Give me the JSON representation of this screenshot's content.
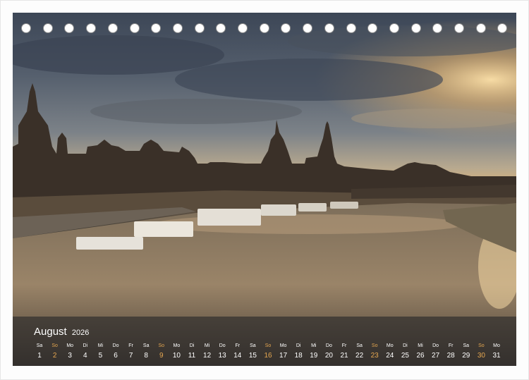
{
  "calendar": {
    "month": "August",
    "year": "2026",
    "days": [
      {
        "wd": "Sa",
        "n": "1",
        "sunday": false
      },
      {
        "wd": "So",
        "n": "2",
        "sunday": true
      },
      {
        "wd": "Mo",
        "n": "3",
        "sunday": false
      },
      {
        "wd": "Di",
        "n": "4",
        "sunday": false
      },
      {
        "wd": "Mi",
        "n": "5",
        "sunday": false
      },
      {
        "wd": "Do",
        "n": "6",
        "sunday": false
      },
      {
        "wd": "Fr",
        "n": "7",
        "sunday": false
      },
      {
        "wd": "Sa",
        "n": "8",
        "sunday": false
      },
      {
        "wd": "So",
        "n": "9",
        "sunday": true
      },
      {
        "wd": "Mo",
        "n": "10",
        "sunday": false
      },
      {
        "wd": "Di",
        "n": "11",
        "sunday": false
      },
      {
        "wd": "Mi",
        "n": "12",
        "sunday": false
      },
      {
        "wd": "Do",
        "n": "13",
        "sunday": false
      },
      {
        "wd": "Fr",
        "n": "14",
        "sunday": false
      },
      {
        "wd": "Sa",
        "n": "15",
        "sunday": false
      },
      {
        "wd": "So",
        "n": "16",
        "sunday": true
      },
      {
        "wd": "Mo",
        "n": "17",
        "sunday": false
      },
      {
        "wd": "Di",
        "n": "18",
        "sunday": false
      },
      {
        "wd": "Mi",
        "n": "19",
        "sunday": false
      },
      {
        "wd": "Do",
        "n": "20",
        "sunday": false
      },
      {
        "wd": "Fr",
        "n": "21",
        "sunday": false
      },
      {
        "wd": "Sa",
        "n": "22",
        "sunday": false
      },
      {
        "wd": "So",
        "n": "23",
        "sunday": true
      },
      {
        "wd": "Mo",
        "n": "24",
        "sunday": false
      },
      {
        "wd": "Di",
        "n": "25",
        "sunday": false
      },
      {
        "wd": "Mi",
        "n": "26",
        "sunday": false
      },
      {
        "wd": "Do",
        "n": "27",
        "sunday": false
      },
      {
        "wd": "Fr",
        "n": "28",
        "sunday": false
      },
      {
        "wd": "Sa",
        "n": "29",
        "sunday": false
      },
      {
        "wd": "So",
        "n": "30",
        "sunday": true
      },
      {
        "wd": "Mo",
        "n": "31",
        "sunday": false
      }
    ]
  },
  "colors": {
    "sunday": "#e4a650",
    "text": "#ffffff",
    "band": "#262628"
  }
}
